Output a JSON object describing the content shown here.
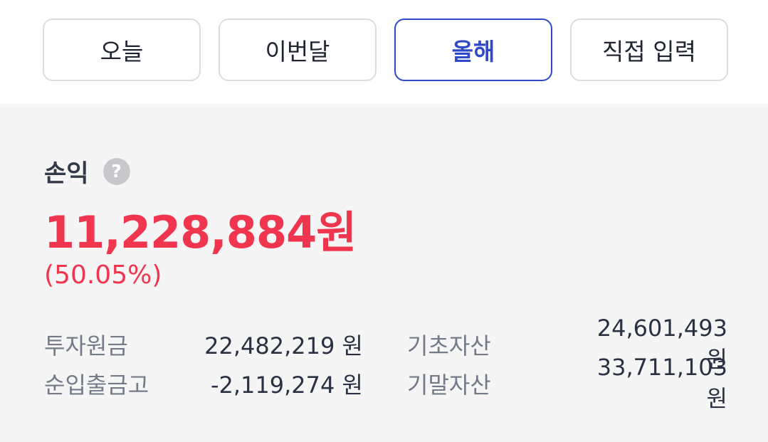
{
  "tabs": [
    {
      "label": "오늘",
      "active": false
    },
    {
      "label": "이번달",
      "active": false
    },
    {
      "label": "올해",
      "active": true
    },
    {
      "label": "직접 입력",
      "active": false
    }
  ],
  "summary": {
    "label": "손익",
    "help_icon": "?",
    "amount": "11,228,884원",
    "rate": "(50.05%)"
  },
  "details": [
    {
      "label_left": "투자원금",
      "value_left": "22,482,219 원",
      "label_right": "기초자산",
      "value_right": "24,601,493 원"
    },
    {
      "label_left": "순입출금고",
      "value_left": "-2,119,274 원",
      "label_right": "기말자산",
      "value_right": "33,711,103 원"
    }
  ],
  "colors": {
    "accent": "#2f49c9",
    "profit": "#f0354f",
    "panel_bg": "#f5f5f6"
  }
}
